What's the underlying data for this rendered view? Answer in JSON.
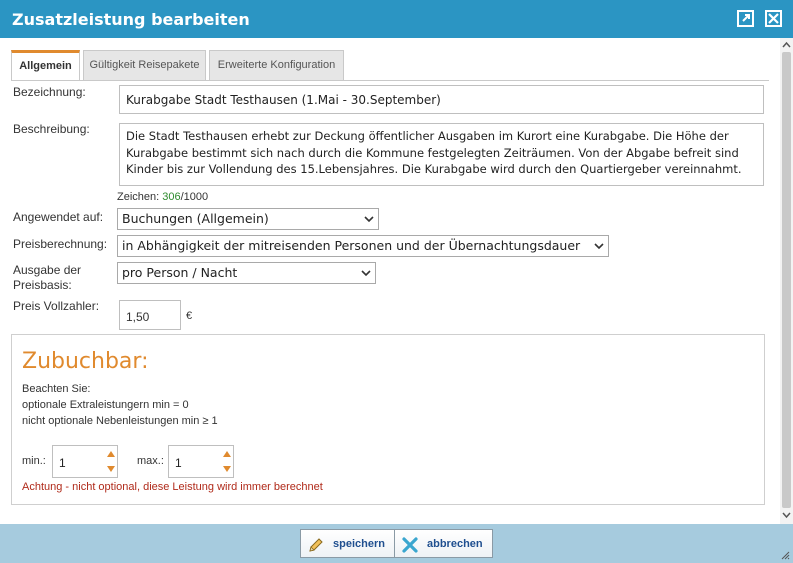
{
  "window": {
    "title": "Zusatzleistung bearbeiten",
    "maximize_icon": "maximize-icon",
    "close_icon": "close-icon"
  },
  "tabs": [
    {
      "label": "Allgemein",
      "active": true
    },
    {
      "label": "Gültigkeit Reisepakete",
      "active": false
    },
    {
      "label": "Erweiterte Konfiguration",
      "active": false
    }
  ],
  "form": {
    "bezeichnung_label": "Bezeichnung:",
    "bezeichnung_value": "Kurabgabe Stadt Testhausen (1.Mai - 30.September)",
    "beschreibung_label": "Beschreibung:",
    "beschreibung_value": "Die Stadt Testhausen erhebt zur Deckung öffentlicher Ausgaben im Kurort eine Kurabgabe. Die Höhe der Kurabgabe bestimmt sich nach durch die Kommune festgelegten Zeiträumen. Von der Abgabe befreit sind Kinder bis zur Vollendung des 15.Lebensjahres. Die Kurabgabe wird durch den Quartiergeber vereinnahmt.",
    "zeichen_label": "Zeichen:",
    "zeichen_count": "306",
    "zeichen_max": "/1000",
    "angewendet_label": "Angewendet auf:",
    "angewendet_value": "Buchungen (Allgemein)",
    "preisberechnung_label": "Preisberechnung:",
    "preisberechnung_value": "in Abhängigkeit der mitreisenden Personen und der Übernachtungsdauer",
    "ausgabe_label_1": "Ausgabe der",
    "ausgabe_label_2": "Preisbasis:",
    "ausgabe_value": "pro Person / Nacht",
    "preis_label": "Preis Vollzahler:",
    "preis_value": "1,50",
    "currency": "€"
  },
  "zubuchbar": {
    "title": "Zubuchbar:",
    "note_1": "Beachten Sie:",
    "note_2": "optionale Extraleistungern min = 0",
    "note_3": "nicht optionale Nebenleistungen min ≥ 1",
    "min_label": "min.:",
    "min_value": "1",
    "max_label": "max.:",
    "max_value": "1",
    "warning": "Achtung - nicht optional, diese Leistung wird immer berechnet"
  },
  "footer": {
    "save_label": "speichern",
    "cancel_label": "abbrechen"
  },
  "colors": {
    "titlebar": "#2b95c3",
    "accent_orange": "#e08a2e",
    "footer": "#a6cbde",
    "warning": "#b02a1a",
    "count_green": "#2e8b2e"
  }
}
